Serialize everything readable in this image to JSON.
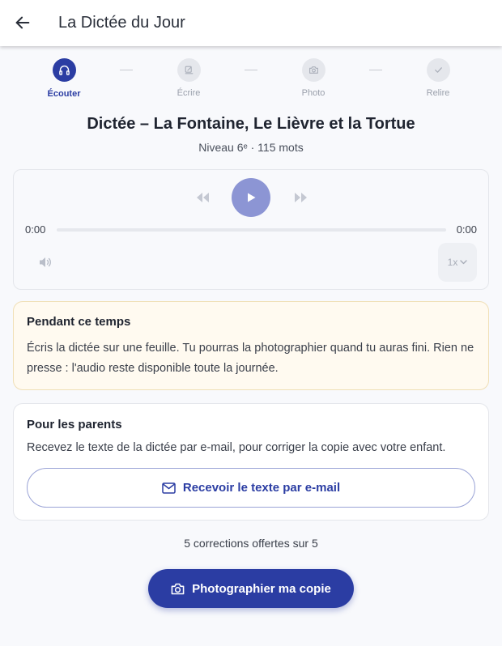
{
  "appbar": {
    "title": "La Dictée du Jour",
    "back_icon": "arrow-left-icon"
  },
  "stepper": {
    "steps": [
      {
        "label": "Écouter",
        "icon": "headphones-icon",
        "state": "active"
      },
      {
        "label": "Écrire",
        "icon": "edit-icon",
        "state": "inactive"
      },
      {
        "label": "Photo",
        "icon": "camera-icon",
        "state": "inactive"
      },
      {
        "label": "Relire",
        "icon": "check-icon",
        "state": "inactive"
      }
    ]
  },
  "dictation": {
    "title": "Dictée – La Fontaine, Le Lièvre et la Tortue",
    "subtitle": "Niveau 6ᵉ · 115 mots"
  },
  "player": {
    "current_time": "0:00",
    "duration": "0:00",
    "progress": 0,
    "speed": "1x",
    "icons": [
      "rewind-icon",
      "play-icon",
      "fast-forward-icon",
      "volume-icon",
      "chevron-down-icon"
    ]
  },
  "info_card": {
    "title": "Pendant ce temps",
    "body": "Écris la dictée sur une feuille. Tu pourras la photographier quand tu auras fini. Rien ne presse : l'audio reste disponible toute la journée."
  },
  "parent_card": {
    "title": "Pour les parents",
    "body": "Recevez le texte de la dictée par e-mail, pour corriger la copie avec votre enfant.",
    "button_label": "Recevoir le texte par e-mail",
    "button_icon": "mail-icon"
  },
  "footer": {
    "quota": "5 corrections offertes sur 5",
    "photo_button_label": "Photographier ma copie",
    "photo_button_icon": "camera-icon"
  },
  "colors": {
    "primary": "#2b3da3",
    "play_button": "#8c95d4",
    "info_background": "#fffaf0",
    "info_border": "#f0dfb6",
    "page_background": "#f8f9fc"
  }
}
